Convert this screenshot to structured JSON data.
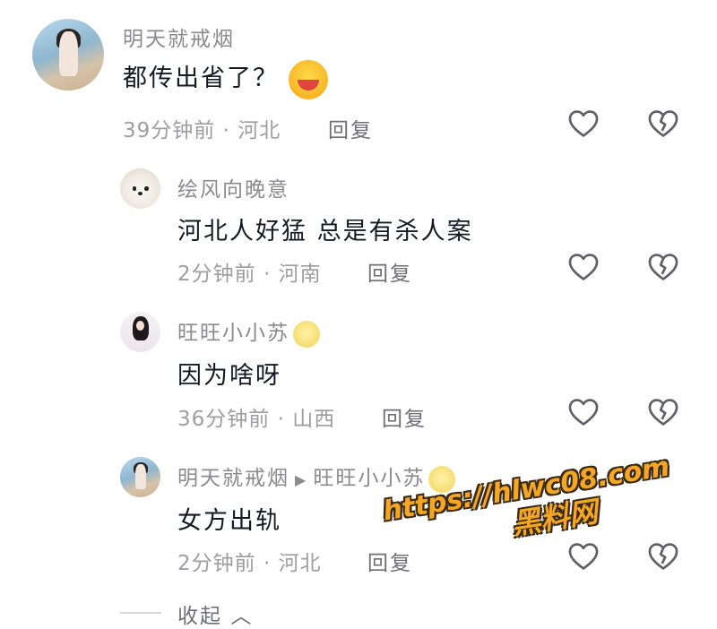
{
  "comments": [
    {
      "name": "明天就戒烟",
      "text": "都传出省了？",
      "emoji": "laughing-crying-emoji",
      "meta": "39分钟前 · 河北",
      "reply_label": "回复"
    },
    {
      "name": "绘风向晚意",
      "text": "河北人好猛 总是有杀人案",
      "meta": "2分钟前 · 河南",
      "reply_label": "回复"
    },
    {
      "name": "旺旺小小苏",
      "emoji": "wink-emoji",
      "text": "因为啥呀",
      "meta": "36分钟前 · 山西",
      "reply_label": "回复"
    },
    {
      "name": "明天就戒烟",
      "reply_to": "旺旺小小苏",
      "emoji": "wink-emoji",
      "text": "女方出轨",
      "meta": "2分钟前 · 河北",
      "reply_label": "回复"
    }
  ],
  "collapse_label": "收起",
  "watermark": {
    "url": "https://hlwc08.com",
    "name": "黑料网"
  },
  "colors": {
    "watermark": "#f5a623",
    "text": "#161823",
    "muted": "#9d9da3"
  }
}
